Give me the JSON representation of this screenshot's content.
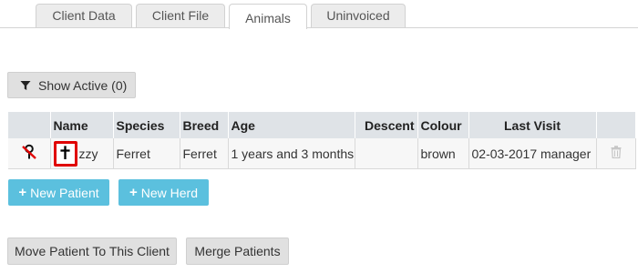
{
  "tabs": [
    {
      "label": "Client Data",
      "active": false
    },
    {
      "label": "Client File",
      "active": false
    },
    {
      "label": "Animals",
      "active": true
    },
    {
      "label": "Uninvoiced",
      "active": false
    }
  ],
  "filter": {
    "label": "Show Active (0)",
    "icon": "filter-icon"
  },
  "table": {
    "headers": [
      "",
      "Name",
      "Species",
      "Breed",
      "Age",
      "Descent",
      "Colour",
      "Last Visit",
      ""
    ],
    "rows": [
      {
        "status_icon": "deceased-pin-icon",
        "name_icon": "cross-icon",
        "name": "zzy",
        "species": "Ferret",
        "breed": "Ferret",
        "age": "1 years and 3 months",
        "descent": "",
        "colour": "brown",
        "last_visit": "02-03-2017 manager",
        "action_icon": "trash-icon"
      }
    ]
  },
  "actions": {
    "new_patient": "New Patient",
    "new_herd": "New Herd",
    "move_patient": "Move Patient To This Client",
    "merge_patients": "Merge Patients"
  },
  "colors": {
    "accent": "#5bc0de",
    "highlight_border": "#e00000",
    "pin_icon": "#e00000"
  }
}
